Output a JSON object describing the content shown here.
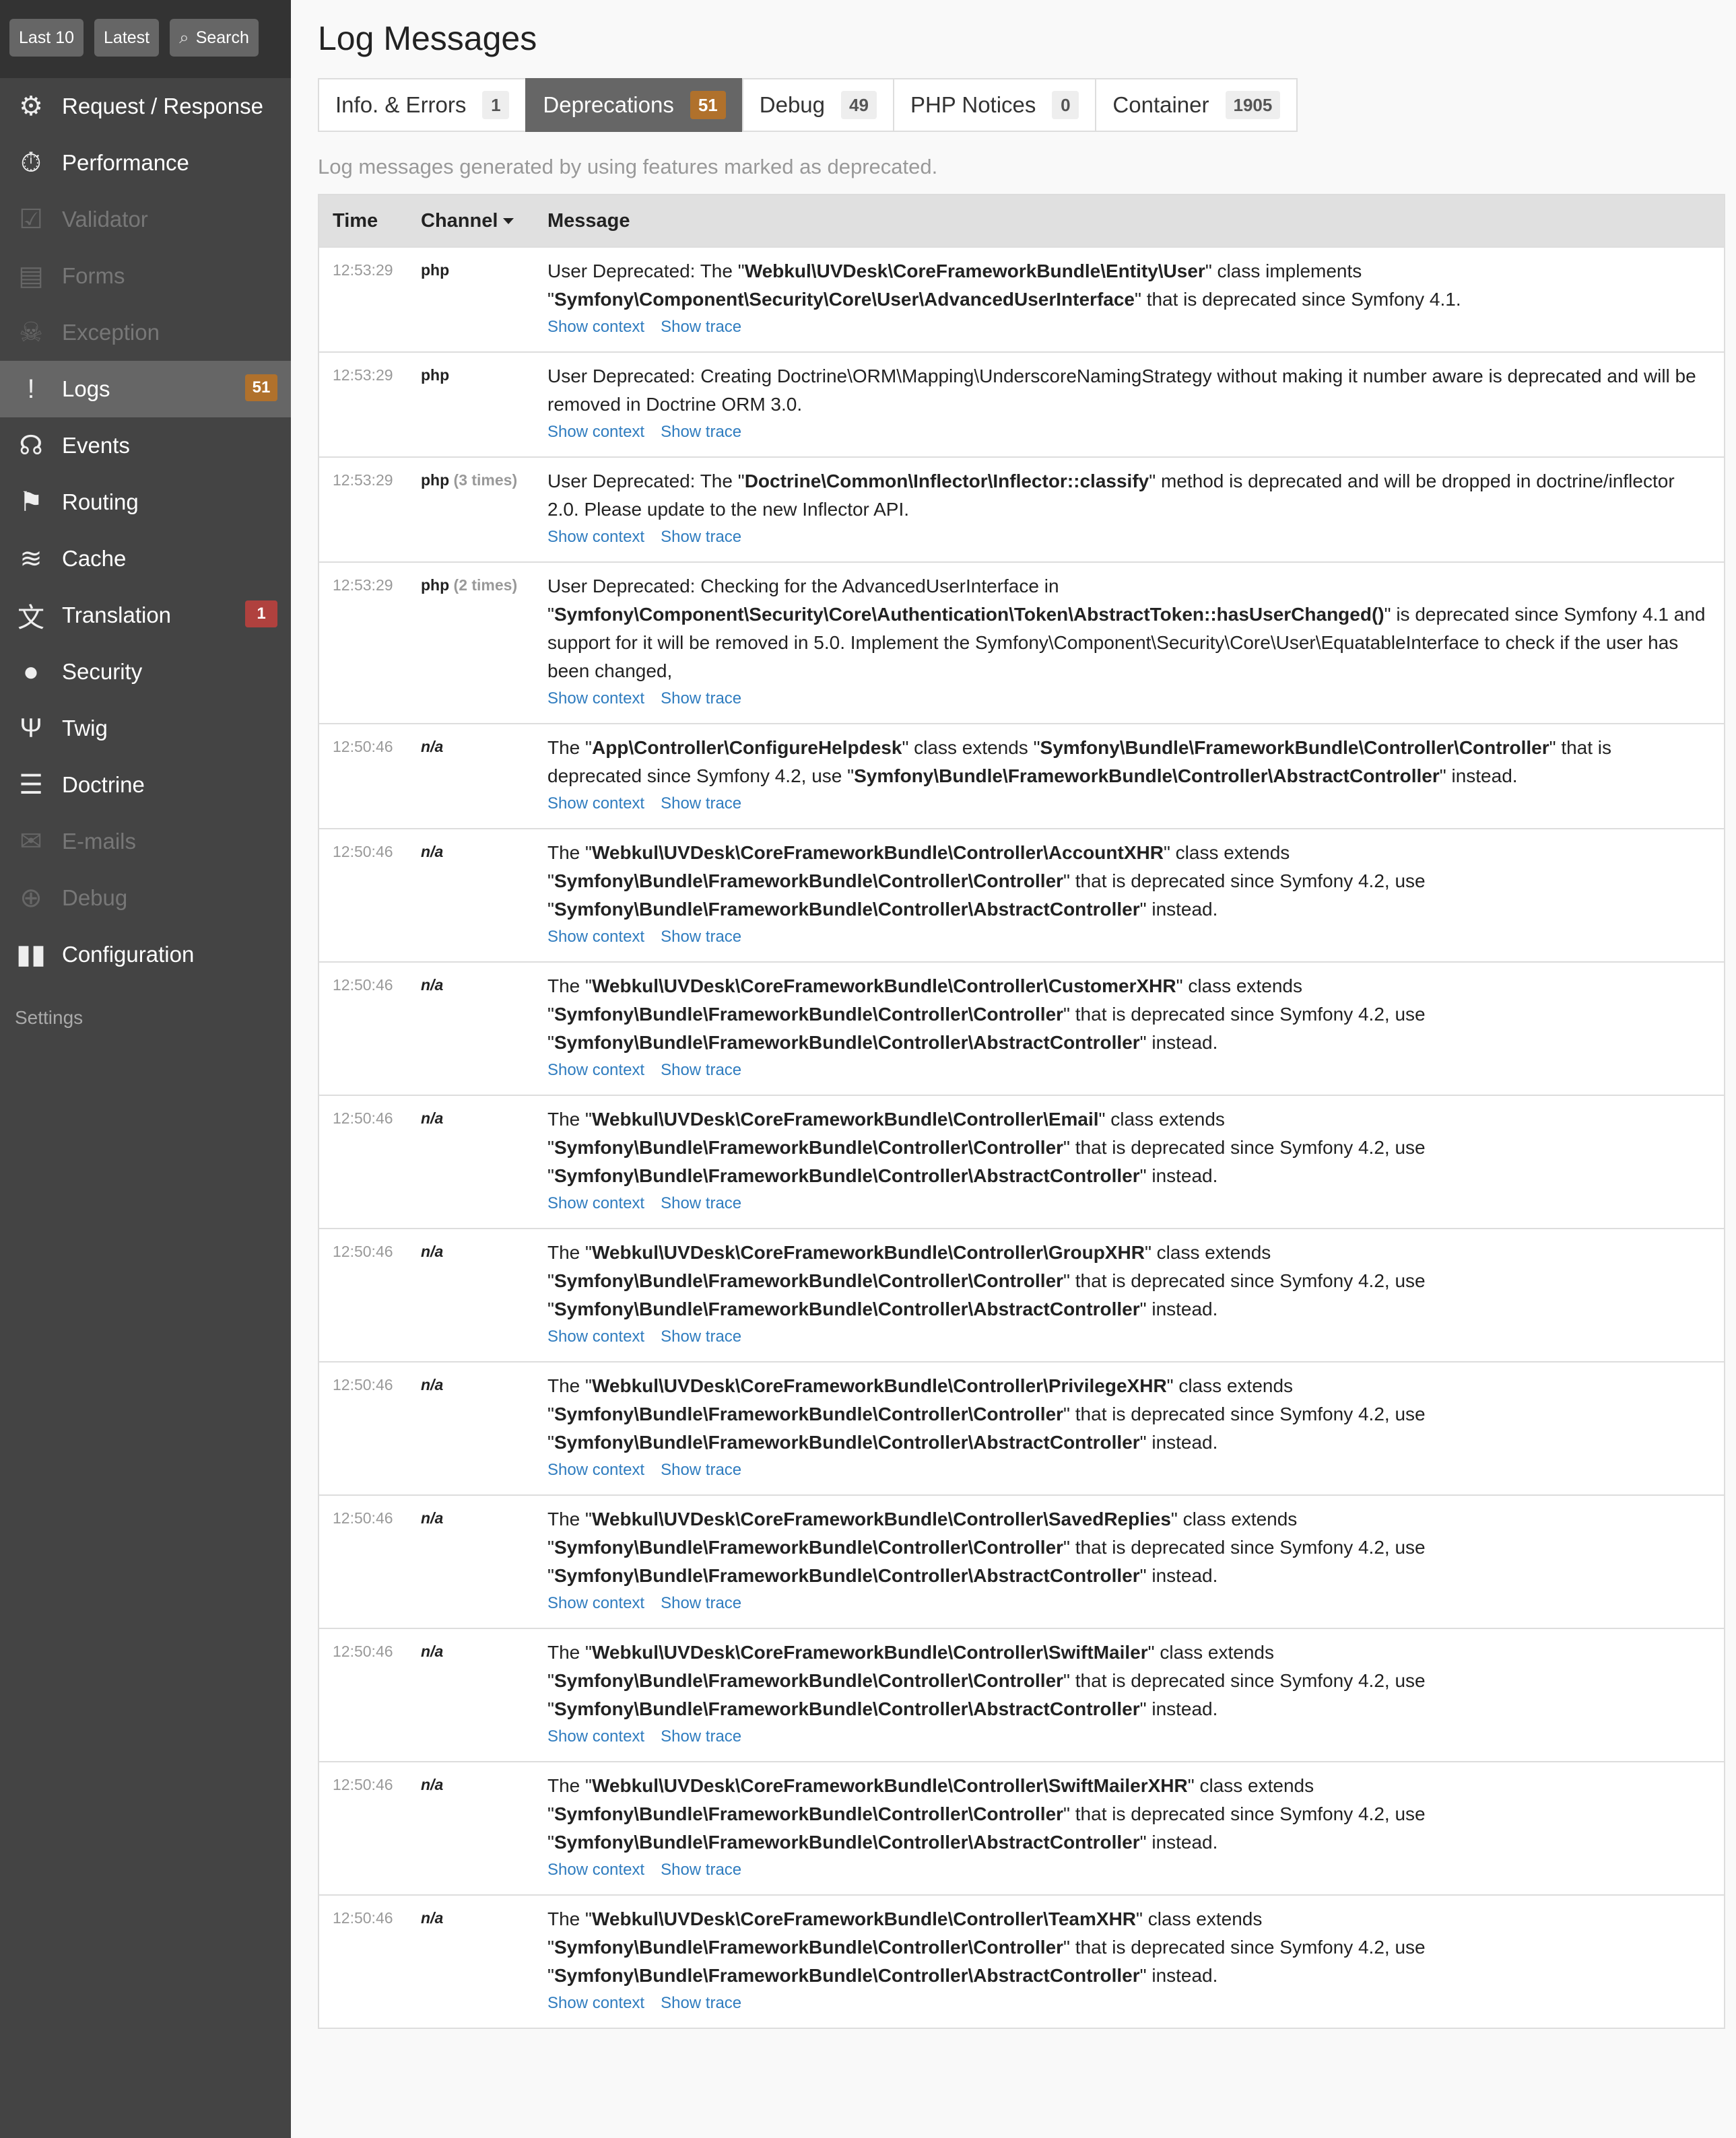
{
  "shortcuts": [
    {
      "label": "Last 10"
    },
    {
      "label": "Latest"
    },
    {
      "label": "Search"
    }
  ],
  "menu": [
    {
      "label": "Request / Response",
      "icon": "gears-icon",
      "glyph": "⚙",
      "disabled": false
    },
    {
      "label": "Performance",
      "icon": "stopwatch-icon",
      "glyph": "⏱",
      "disabled": false
    },
    {
      "label": "Validator",
      "icon": "checkbox-icon",
      "glyph": "☑",
      "disabled": true
    },
    {
      "label": "Forms",
      "icon": "clipboard-icon",
      "glyph": "▤",
      "disabled": true
    },
    {
      "label": "Exception",
      "icon": "ghost-icon",
      "glyph": "☠",
      "disabled": true
    },
    {
      "label": "Logs",
      "icon": "alert-icon",
      "glyph": "!",
      "disabled": false,
      "selected": true,
      "count": "51",
      "count_color": "#b0712c"
    },
    {
      "label": "Events",
      "icon": "broadcast-icon",
      "glyph": "☊",
      "disabled": false
    },
    {
      "label": "Routing",
      "icon": "signpost-icon",
      "glyph": "⚑",
      "disabled": false
    },
    {
      "label": "Cache",
      "icon": "layers-icon",
      "glyph": "≋",
      "disabled": false
    },
    {
      "label": "Translation",
      "icon": "translate-icon",
      "glyph": "文",
      "disabled": false,
      "count": "1",
      "count_color": "#b0413e"
    },
    {
      "label": "Security",
      "icon": "user-icon",
      "glyph": "●",
      "disabled": false
    },
    {
      "label": "Twig",
      "icon": "twig-icon",
      "glyph": "Ψ",
      "disabled": false
    },
    {
      "label": "Doctrine",
      "icon": "database-icon",
      "glyph": "☰",
      "disabled": false
    },
    {
      "label": "E-mails",
      "icon": "envelope-icon",
      "glyph": "✉",
      "disabled": true
    },
    {
      "label": "Debug",
      "icon": "crosshair-icon",
      "glyph": "⊕",
      "disabled": true
    },
    {
      "label": "Configuration",
      "icon": "toggles-icon",
      "glyph": "▮▮",
      "disabled": false
    }
  ],
  "settings_label": "Settings",
  "page_title": "Log Messages",
  "tabs": [
    {
      "label": "Info. & Errors",
      "count": "1",
      "active": false
    },
    {
      "label": "Deprecations",
      "count": "51",
      "active": true
    },
    {
      "label": "Debug",
      "count": "49",
      "active": false
    },
    {
      "label": "PHP Notices",
      "count": "0",
      "active": false
    },
    {
      "label": "Container",
      "count": "1905",
      "active": false
    }
  ],
  "help_text": "Log messages generated by using features marked as deprecated.",
  "columns": {
    "time": "Time",
    "channel": "Channel",
    "message": "Message"
  },
  "links": {
    "context": "Show context",
    "trace": "Show trace"
  },
  "rows": [
    {
      "time": "12:53:29",
      "channel": "php",
      "italic": false,
      "times": "",
      "parts": [
        [
          "User Deprecated: The \"",
          false
        ],
        [
          "Webkul\\UVDesk\\CoreFrameworkBundle\\Entity\\User",
          true
        ],
        [
          "\" class implements \"",
          false
        ],
        [
          "Symfony\\Component\\Security\\Core\\User\\AdvancedUserInterface",
          true
        ],
        [
          "\" that is deprecated since Symfony 4.1.",
          false
        ]
      ]
    },
    {
      "time": "12:53:29",
      "channel": "php",
      "italic": false,
      "times": "",
      "parts": [
        [
          "User Deprecated: Creating Doctrine\\ORM\\Mapping\\UnderscoreNamingStrategy without making it number aware is deprecated and will be removed in Doctrine ORM 3.0.",
          false
        ]
      ]
    },
    {
      "time": "12:53:29",
      "channel": "php",
      "italic": false,
      "times": "(3 times)",
      "parts": [
        [
          "User Deprecated: The \"",
          false
        ],
        [
          "Doctrine\\Common\\Inflector\\Inflector::classify",
          true
        ],
        [
          "\" method is deprecated and will be dropped in doctrine/inflector 2.0. Please update to the new Inflector API.",
          false
        ]
      ]
    },
    {
      "time": "12:53:29",
      "channel": "php",
      "italic": false,
      "times": "(2 times)",
      "parts": [
        [
          "User Deprecated: Checking for the AdvancedUserInterface in \"",
          false
        ],
        [
          "Symfony\\Component\\Security\\Core\\Authentication\\Token\\AbstractToken::hasUserChanged()",
          true
        ],
        [
          "\" is deprecated since Symfony 4.1 and support for it will be removed in 5.0. Implement the Symfony\\Component\\Security\\Core\\User\\EquatableInterface to check if the user has been changed,",
          false
        ]
      ]
    },
    {
      "time": "12:50:46",
      "channel": "n/a",
      "italic": true,
      "times": "",
      "parts": [
        [
          "The \"",
          false
        ],
        [
          "App\\Controller\\ConfigureHelpdesk",
          true
        ],
        [
          "\" class extends \"",
          false
        ],
        [
          "Symfony\\Bundle\\FrameworkBundle\\Controller\\Controller",
          true
        ],
        [
          "\" that is deprecated since Symfony 4.2, use \"",
          false
        ],
        [
          "Symfony\\Bundle\\FrameworkBundle\\Controller\\AbstractController",
          true
        ],
        [
          "\" instead.",
          false
        ]
      ]
    },
    {
      "time": "12:50:46",
      "channel": "n/a",
      "italic": true,
      "times": "",
      "parts": [
        [
          "The \"",
          false
        ],
        [
          "Webkul\\UVDesk\\CoreFrameworkBundle\\Controller\\AccountXHR",
          true
        ],
        [
          "\" class extends \"",
          false
        ],
        [
          "Symfony\\Bundle\\FrameworkBundle\\Controller\\Controller",
          true
        ],
        [
          "\" that is deprecated since Symfony 4.2, use \"",
          false
        ],
        [
          "Symfony\\Bundle\\FrameworkBundle\\Controller\\AbstractController",
          true
        ],
        [
          "\" instead.",
          false
        ]
      ]
    },
    {
      "time": "12:50:46",
      "channel": "n/a",
      "italic": true,
      "times": "",
      "parts": [
        [
          "The \"",
          false
        ],
        [
          "Webkul\\UVDesk\\CoreFrameworkBundle\\Controller\\CustomerXHR",
          true
        ],
        [
          "\" class extends \"",
          false
        ],
        [
          "Symfony\\Bundle\\FrameworkBundle\\Controller\\Controller",
          true
        ],
        [
          "\" that is deprecated since Symfony 4.2, use \"",
          false
        ],
        [
          "Symfony\\Bundle\\FrameworkBundle\\Controller\\AbstractController",
          true
        ],
        [
          "\" instead.",
          false
        ]
      ]
    },
    {
      "time": "12:50:46",
      "channel": "n/a",
      "italic": true,
      "times": "",
      "parts": [
        [
          "The \"",
          false
        ],
        [
          "Webkul\\UVDesk\\CoreFrameworkBundle\\Controller\\Email",
          true
        ],
        [
          "\" class extends \"",
          false
        ],
        [
          "Symfony\\Bundle\\FrameworkBundle\\Controller\\Controller",
          true
        ],
        [
          "\" that is deprecated since Symfony 4.2, use \"",
          false
        ],
        [
          "Symfony\\Bundle\\FrameworkBundle\\Controller\\AbstractController",
          true
        ],
        [
          "\" instead.",
          false
        ]
      ]
    },
    {
      "time": "12:50:46",
      "channel": "n/a",
      "italic": true,
      "times": "",
      "parts": [
        [
          "The \"",
          false
        ],
        [
          "Webkul\\UVDesk\\CoreFrameworkBundle\\Controller\\GroupXHR",
          true
        ],
        [
          "\" class extends \"",
          false
        ],
        [
          "Symfony\\Bundle\\FrameworkBundle\\Controller\\Controller",
          true
        ],
        [
          "\" that is deprecated since Symfony 4.2, use \"",
          false
        ],
        [
          "Symfony\\Bundle\\FrameworkBundle\\Controller\\AbstractController",
          true
        ],
        [
          "\" instead.",
          false
        ]
      ]
    },
    {
      "time": "12:50:46",
      "channel": "n/a",
      "italic": true,
      "times": "",
      "parts": [
        [
          "The \"",
          false
        ],
        [
          "Webkul\\UVDesk\\CoreFrameworkBundle\\Controller\\PrivilegeXHR",
          true
        ],
        [
          "\" class extends \"",
          false
        ],
        [
          "Symfony\\Bundle\\FrameworkBundle\\Controller\\Controller",
          true
        ],
        [
          "\" that is deprecated since Symfony 4.2, use \"",
          false
        ],
        [
          "Symfony\\Bundle\\FrameworkBundle\\Controller\\AbstractController",
          true
        ],
        [
          "\" instead.",
          false
        ]
      ]
    },
    {
      "time": "12:50:46",
      "channel": "n/a",
      "italic": true,
      "times": "",
      "parts": [
        [
          "The \"",
          false
        ],
        [
          "Webkul\\UVDesk\\CoreFrameworkBundle\\Controller\\SavedReplies",
          true
        ],
        [
          "\" class extends \"",
          false
        ],
        [
          "Symfony\\Bundle\\FrameworkBundle\\Controller\\Controller",
          true
        ],
        [
          "\" that is deprecated since Symfony 4.2, use \"",
          false
        ],
        [
          "Symfony\\Bundle\\FrameworkBundle\\Controller\\AbstractController",
          true
        ],
        [
          "\" instead.",
          false
        ]
      ]
    },
    {
      "time": "12:50:46",
      "channel": "n/a",
      "italic": true,
      "times": "",
      "parts": [
        [
          "The \"",
          false
        ],
        [
          "Webkul\\UVDesk\\CoreFrameworkBundle\\Controller\\SwiftMailer",
          true
        ],
        [
          "\" class extends \"",
          false
        ],
        [
          "Symfony\\Bundle\\FrameworkBundle\\Controller\\Controller",
          true
        ],
        [
          "\" that is deprecated since Symfony 4.2, use \"",
          false
        ],
        [
          "Symfony\\Bundle\\FrameworkBundle\\Controller\\AbstractController",
          true
        ],
        [
          "\" instead.",
          false
        ]
      ]
    },
    {
      "time": "12:50:46",
      "channel": "n/a",
      "italic": true,
      "times": "",
      "parts": [
        [
          "The \"",
          false
        ],
        [
          "Webkul\\UVDesk\\CoreFrameworkBundle\\Controller\\SwiftMailerXHR",
          true
        ],
        [
          "\" class extends \"",
          false
        ],
        [
          "Symfony\\Bundle\\FrameworkBundle\\Controller\\Controller",
          true
        ],
        [
          "\" that is deprecated since Symfony 4.2, use \"",
          false
        ],
        [
          "Symfony\\Bundle\\FrameworkBundle\\Controller\\AbstractController",
          true
        ],
        [
          "\" instead.",
          false
        ]
      ]
    },
    {
      "time": "12:50:46",
      "channel": "n/a",
      "italic": true,
      "times": "",
      "parts": [
        [
          "The \"",
          false
        ],
        [
          "Webkul\\UVDesk\\CoreFrameworkBundle\\Controller\\TeamXHR",
          true
        ],
        [
          "\" class extends \"",
          false
        ],
        [
          "Symfony\\Bundle\\FrameworkBundle\\Controller\\Controller",
          true
        ],
        [
          "\" that is deprecated since Symfony 4.2, use \"",
          false
        ],
        [
          "Symfony\\Bundle\\FrameworkBundle\\Controller\\AbstractController",
          true
        ],
        [
          "\" instead.",
          false
        ]
      ]
    }
  ]
}
